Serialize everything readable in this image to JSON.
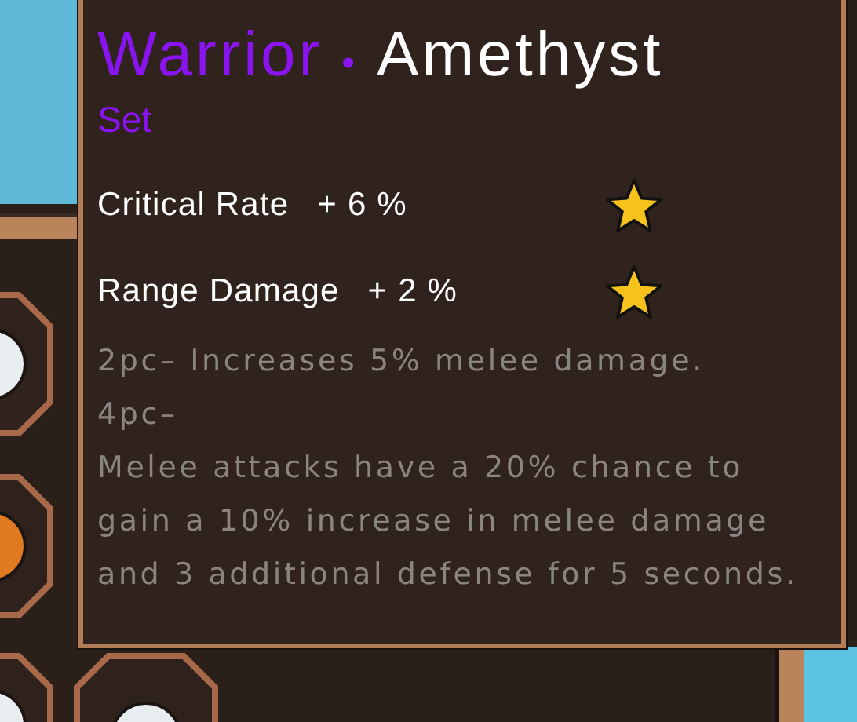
{
  "tooltip": {
    "title": {
      "set_name": "Warrior",
      "separator": "•",
      "gem": "Amethyst"
    },
    "subtitle": "Set",
    "stats": [
      {
        "name": "Critical Rate",
        "value": "+ 6 %"
      },
      {
        "name": "Range Damage",
        "value": "+ 2 %"
      }
    ],
    "bonuses": [
      "2pc– Increases 5% melee damage.",
      "4pc–",
      "Melee attacks have a 20% chance to gain a 10% increase in melee damage and 3 additional defense for 5 seconds."
    ]
  }
}
